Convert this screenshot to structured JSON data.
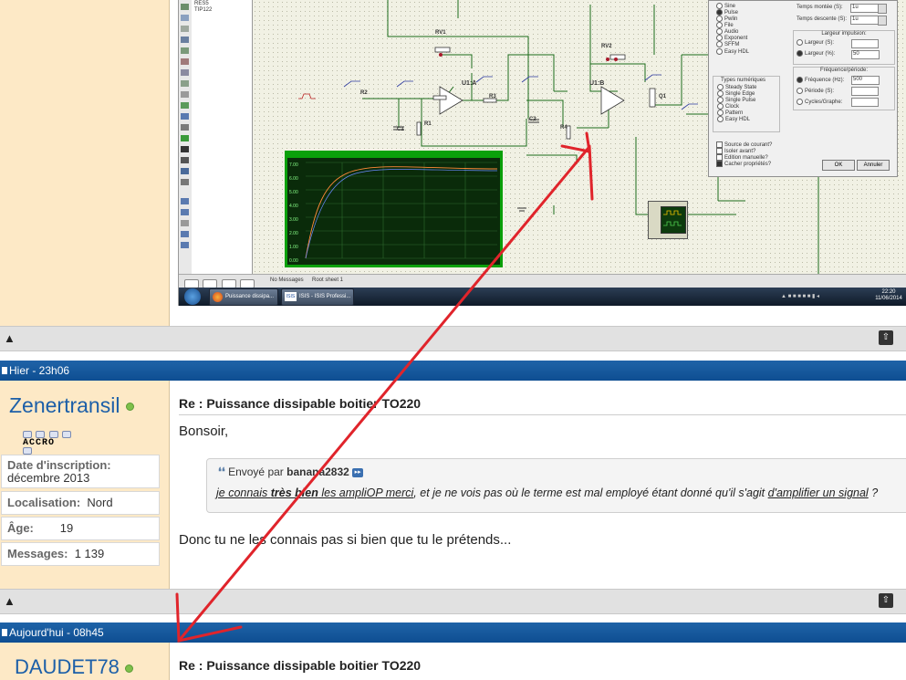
{
  "colors": {
    "accent": "#0f4f94",
    "annotation_arrow": "#e0242b",
    "user_panel": "#fde9c6",
    "online": "#7ec04a"
  },
  "isis": {
    "component_list": [
      "RES5",
      "TIP122"
    ],
    "component_labels": {
      "rv1": "RV1",
      "rv2": "RV2",
      "r2": "R2",
      "r1": "R1",
      "r3": "R3",
      "r4": "R4",
      "c1": "C1",
      "c2": "C2",
      "u1a": "U1:A",
      "u1b": "U1:B",
      "q1": "Q1"
    },
    "status": {
      "messages": "No Messages",
      "sheet": "Root sheet 1"
    },
    "oscillo_yticks": [
      "7.00",
      "6.00",
      "5.00",
      "4.00",
      "3.00",
      "2.00",
      "1.00",
      "0.00"
    ],
    "dialog": {
      "waveform_options": [
        "Sine",
        "Pulse",
        "Pwlin",
        "File",
        "Audio",
        "Exponent",
        "SFFM",
        "Easy HDL"
      ],
      "digital_label": "Types numériques",
      "digital_options": [
        "Steady State",
        "Single Edge",
        "Single Pulse",
        "Clock",
        "Pattern",
        "Easy HDL"
      ],
      "checkboxes": [
        "Source de courant?",
        "Isoler avant?",
        "Edition manuelle?",
        "Cacher propriétés?"
      ],
      "rise_label": "Temps montée (S):",
      "rise_value": "1u",
      "fall_label": "Temps descente (S):",
      "fall_value": "1u",
      "pulse_width_group": "Largeur impulsion:",
      "width_s_label": "Largeur (S):",
      "width_pct_label": "Largeur (%):",
      "width_pct_value": "50",
      "freq_group": "Fréquence/période:",
      "freq_label": "Fréquence (Hz):",
      "freq_value": "500",
      "period_label": "Période (S):",
      "cycles_label": "Cycles/Graphe:",
      "ok": "OK",
      "cancel": "Annuler"
    },
    "taskbar": {
      "app1": "Puissance dissipa...",
      "app2": "ISIS - ISIS Professi...",
      "app2_icon": "ISIS",
      "time": "22:20",
      "date": "11/06/2014"
    }
  },
  "post1": {
    "date": "Hier - 23h06",
    "username": "Zenertransil",
    "rank": "ACCRO",
    "stats": [
      {
        "label": "Date d'inscription:",
        "value": "décembre 2013"
      },
      {
        "label": "Localisation:",
        "value": "Nord"
      },
      {
        "label": "Âge:",
        "value": "19"
      },
      {
        "label": "Messages:",
        "value": "1 139"
      }
    ],
    "title": "Re : Puissance dissipable boitier TO220",
    "greeting": "Bonsoir,",
    "quote": {
      "sent_by": "Envoyé par",
      "author": "banana2832",
      "text_parts": [
        {
          "t": "je connais ",
          "style": "iu"
        },
        {
          "t": "très bien",
          "style": "biu"
        },
        {
          "t": " les ampliOP merci",
          "style": "iu"
        },
        {
          "t": ", et je ne vois pas où le terme est mal employé étant donné qu'il s'agit ",
          "style": "i"
        },
        {
          "t": "d'amplifier un signal",
          "style": "iu"
        },
        {
          "t": " ?",
          "style": "i"
        }
      ]
    },
    "body": "Donc tu ne les connais pas si bien que tu le prétends..."
  },
  "post2": {
    "date": "Aujourd'hui - 08h45",
    "username": "DAUDET78",
    "title": "Re : Puissance dissipable boitier TO220"
  }
}
